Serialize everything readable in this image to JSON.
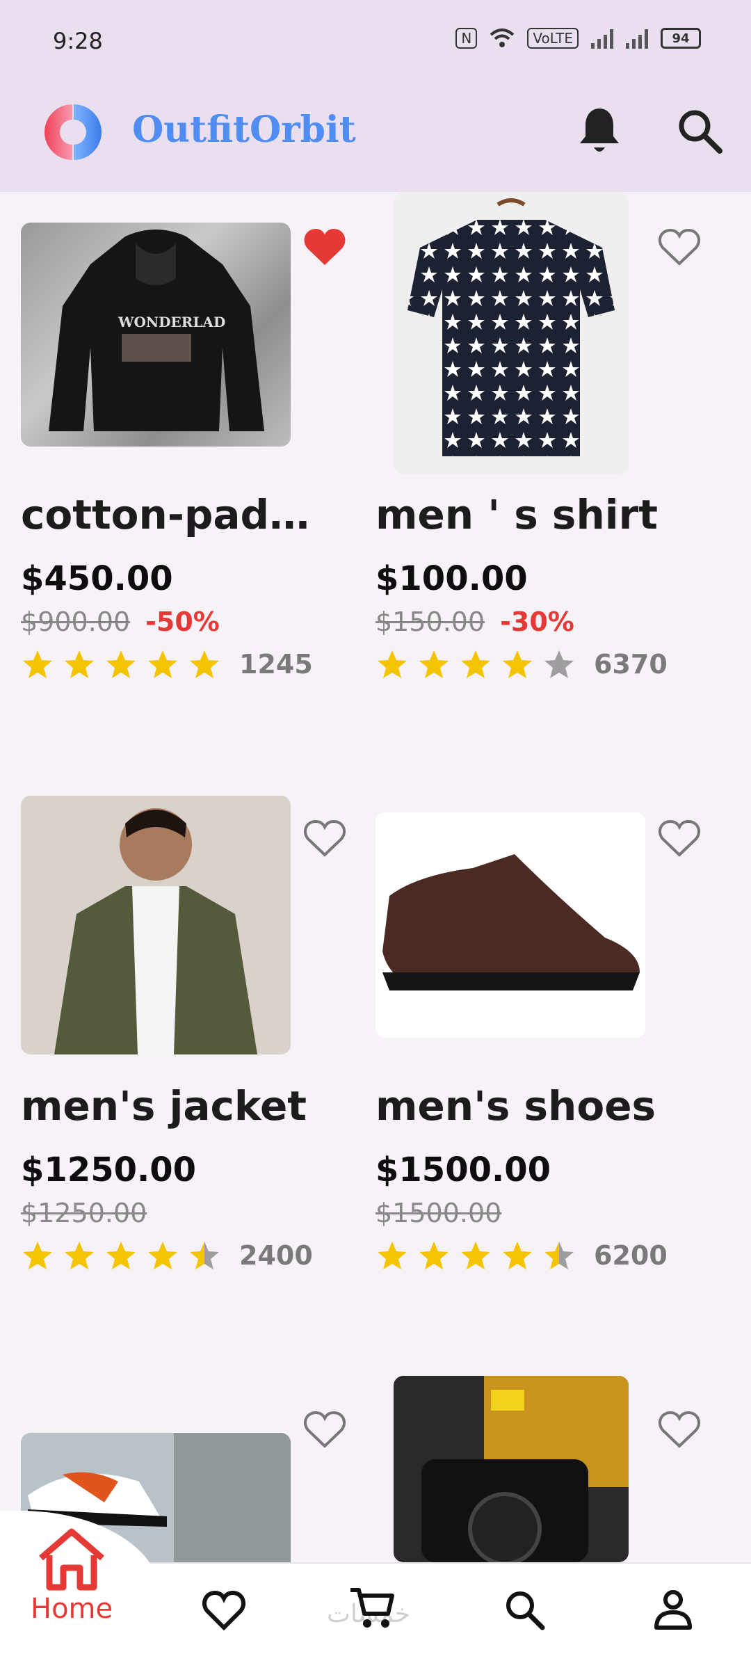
{
  "status_bar": {
    "time": "9:28",
    "network_label": "VoLTE",
    "battery": "94"
  },
  "app": {
    "name": "OutfitOrbit"
  },
  "products": [
    {
      "title": "cotton-padd...",
      "price": "$450.00",
      "old_price": "$900.00",
      "discount": "-50%",
      "rating": 5,
      "reviews": "1245",
      "favorite": true
    },
    {
      "title": "men ' s shirt",
      "price": "$100.00",
      "old_price": "$150.00",
      "discount": "-30%",
      "rating": 4,
      "reviews": "6370",
      "favorite": false
    },
    {
      "title": "men's jacket",
      "price": "$1250.00",
      "old_price": "$1250.00",
      "discount": "",
      "rating": 4.5,
      "reviews": "2400",
      "favorite": false
    },
    {
      "title": "men's shoes",
      "price": "$1500.00",
      "old_price": "$1500.00",
      "discount": "",
      "rating": 4.5,
      "reviews": "6200",
      "favorite": false
    },
    {
      "favorite": false
    },
    {
      "favorite": false
    }
  ],
  "bottom_nav": {
    "items": [
      {
        "label": "Home",
        "icon": "home-icon",
        "active": true
      },
      {
        "label": "",
        "icon": "heart-icon"
      },
      {
        "label": "",
        "icon": "cart-icon"
      },
      {
        "label": "",
        "icon": "search-icon"
      },
      {
        "label": "",
        "icon": "person-icon"
      }
    ]
  },
  "watermark": "خمسات",
  "colors": {
    "accent": "#e53935",
    "brand": "#4f8df2",
    "star": "#f5c400",
    "star_empty": "#9e9e9e",
    "appbar": "#e9dfee"
  }
}
